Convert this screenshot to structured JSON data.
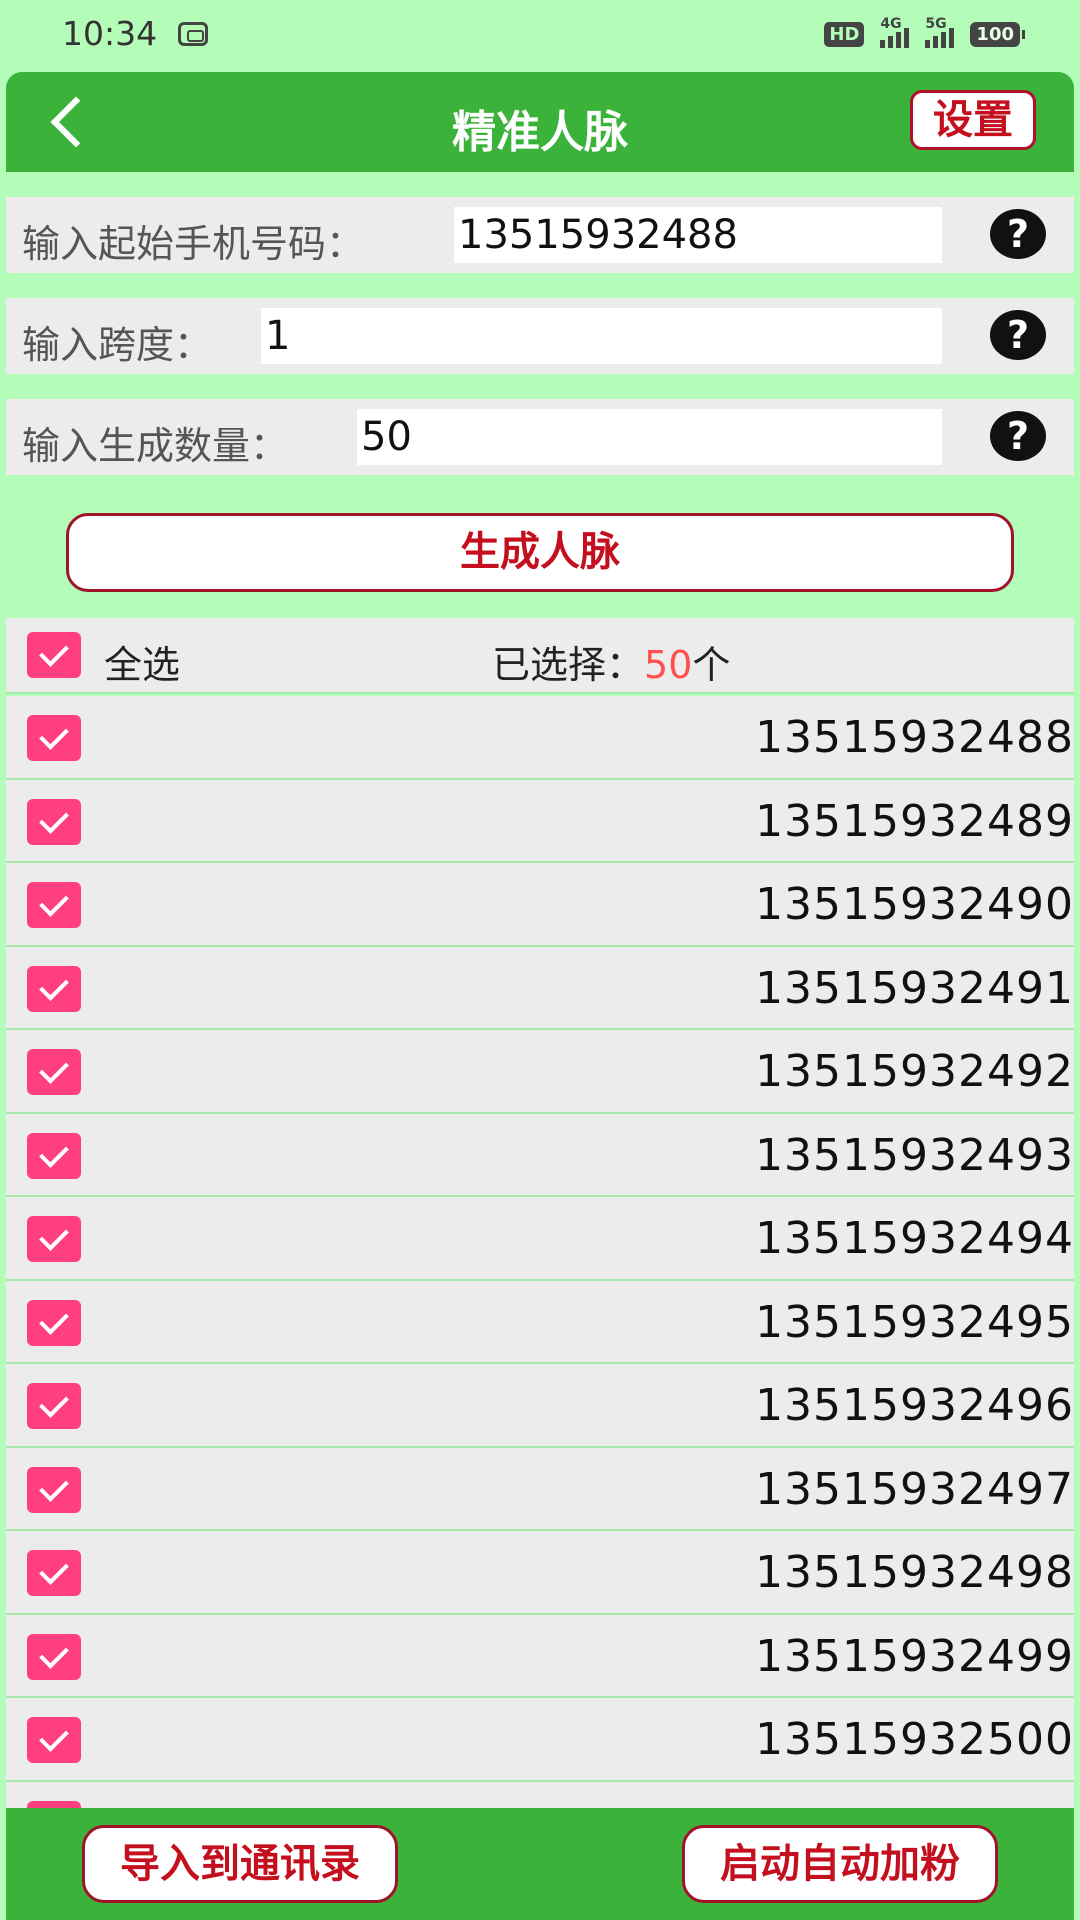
{
  "status": {
    "time": "10:34",
    "hd": "HD",
    "net1": "4G",
    "net2": "5G",
    "battery": "100"
  },
  "header": {
    "title": "精准人脉",
    "settings_label": "设置"
  },
  "inputs": {
    "start_label": "输入起始手机号码：",
    "start_value": "13515932488",
    "span_label": "输入跨度：",
    "span_value": "1",
    "count_label": "输入生成数量：",
    "count_value": "50",
    "help": "?"
  },
  "generate_label": "生成人脉",
  "select_bar": {
    "all_label": "全选",
    "selected_prefix": "已选择：",
    "selected_count": "50",
    "selected_suffix": "个"
  },
  "list": [
    "13515932488",
    "13515932489",
    "13515932490",
    "13515932491",
    "13515932492",
    "13515932493",
    "13515932494",
    "13515932495",
    "13515932496",
    "13515932497",
    "13515932498",
    "13515932499",
    "13515932500"
  ],
  "bottom": {
    "import_label": "导入到通讯录",
    "auto_label": "启动自动加粉"
  },
  "colors": {
    "background": "#b3fdb8",
    "bar_green": "#3bb23a",
    "accent_red": "#c4101e",
    "checkbox_pink": "#ff3f7f",
    "count_red": "#ff5050"
  }
}
